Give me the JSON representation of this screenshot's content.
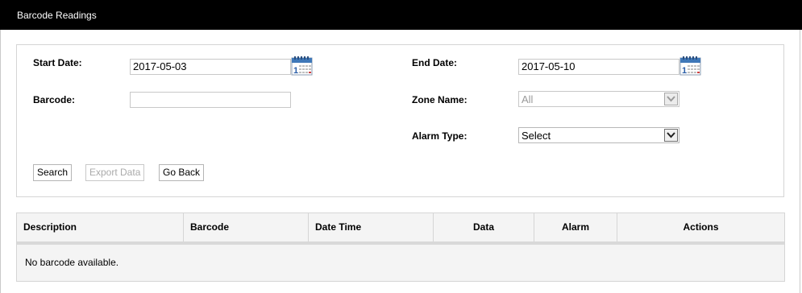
{
  "header": {
    "title": "Barcode Readings"
  },
  "filters": {
    "start_date": {
      "label": "Start Date:",
      "value": "2017-05-03"
    },
    "end_date": {
      "label": "End Date:",
      "value": "2017-05-10"
    },
    "barcode": {
      "label": "Barcode:",
      "value": ""
    },
    "zone_name": {
      "label": "Zone Name:",
      "selected": "All"
    },
    "alarm_type": {
      "label": "Alarm Type:",
      "selected": "Select"
    }
  },
  "buttons": {
    "search": "Search",
    "export": "Export Data",
    "go_back": "Go Back"
  },
  "table": {
    "columns": [
      "Description",
      "Barcode",
      "Date Time",
      "Data",
      "Alarm",
      "Actions"
    ],
    "empty_message": "No barcode available."
  },
  "icons": {
    "calendar": "calendar-icon",
    "dropdown": "chevron-down-icon"
  },
  "colors": {
    "header_bg": "#000000",
    "header_text": "#ffffff",
    "table_bg": "#f4f4f4"
  }
}
